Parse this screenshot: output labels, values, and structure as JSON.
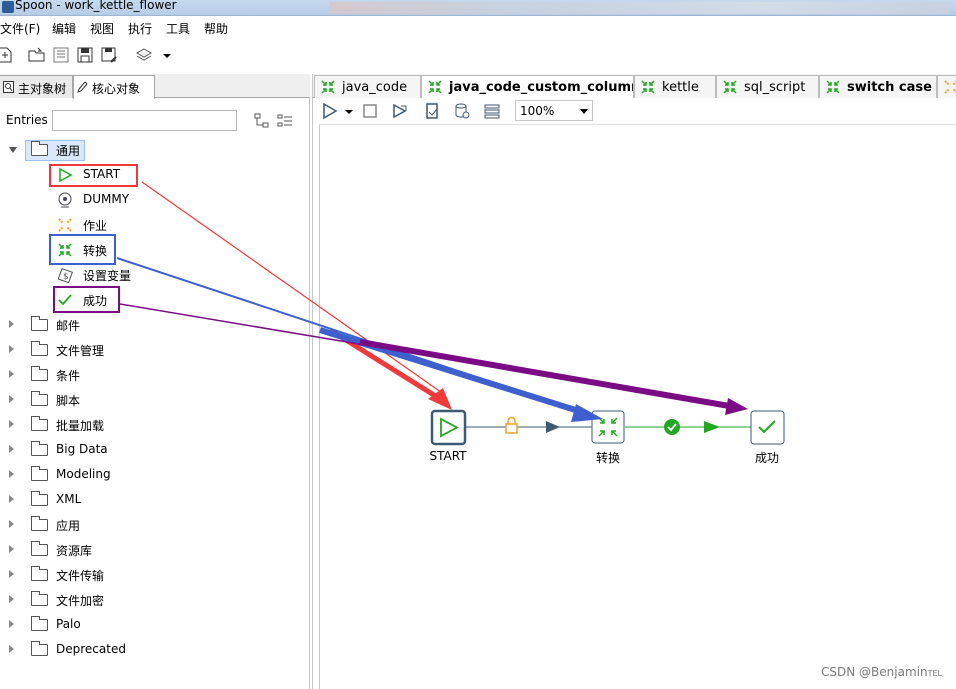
{
  "window": {
    "title": "Spoon - work_kettle_flower"
  },
  "menu": [
    "文件(F)",
    "编辑",
    "视图",
    "执行",
    "工具",
    "帮助"
  ],
  "left_tabs": [
    {
      "label": "主对象树",
      "active": false
    },
    {
      "label": "核心对象",
      "active": true
    }
  ],
  "search": {
    "label": "Entries"
  },
  "tree": {
    "open_folder": "通用",
    "children": [
      "START",
      "DUMMY",
      "作业",
      "转换",
      "设置变量",
      "成功"
    ],
    "folders": [
      "邮件",
      "文件管理",
      "条件",
      "脚本",
      "批量加载",
      "Big Data",
      "Modeling",
      "XML",
      "应用",
      "资源库",
      "文件传输",
      "文件加密",
      "Palo",
      "Deprecated"
    ]
  },
  "editor_tabs": [
    {
      "label": "java_code",
      "bold": false,
      "icon": "transformation-icon"
    },
    {
      "label": "java_code_custom_column",
      "bold": true,
      "icon": "transformation-icon"
    },
    {
      "label": "kettle",
      "bold": false,
      "icon": "transformation-icon"
    },
    {
      "label": "sql_script",
      "bold": false,
      "icon": "transformation-icon"
    },
    {
      "label": "switch case",
      "bold": true,
      "icon": "transformation-icon"
    }
  ],
  "zoom": "100%",
  "canvas": {
    "nodes": [
      {
        "id": "start",
        "label": "START"
      },
      {
        "id": "transform",
        "label": "转换"
      },
      {
        "id": "success",
        "label": "成功"
      }
    ]
  },
  "colors": {
    "red": "#f0393a",
    "blue": "#3e5fce",
    "purple": "#7b0a85",
    "green": "#22a722",
    "node_border": "#3c5a73"
  },
  "watermark": "CSDN @Benjamin",
  "watermark_suffix": "TEL"
}
